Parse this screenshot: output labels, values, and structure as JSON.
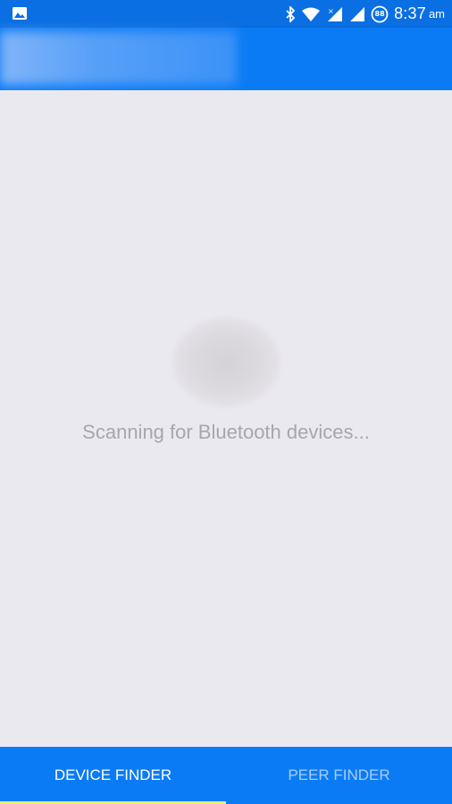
{
  "status_bar": {
    "time": "8:37",
    "ampm": "am",
    "battery_level": "88",
    "icons": [
      "image-icon",
      "bluetooth-icon",
      "wifi-icon",
      "cell-signal-icon",
      "cell-signal-icon",
      "battery-icon"
    ]
  },
  "main": {
    "status_text": "Scanning for Bluetooth devices..."
  },
  "tabs": [
    {
      "label": "DEVICE FINDER",
      "selected": true
    },
    {
      "label": "PEER FINDER",
      "selected": false
    }
  ],
  "colors": {
    "status_bar": "#0a6fe2",
    "app_bar": "#0b7bf5",
    "background": "#ebe9f0",
    "tab_indicator": "#e6f06a"
  }
}
